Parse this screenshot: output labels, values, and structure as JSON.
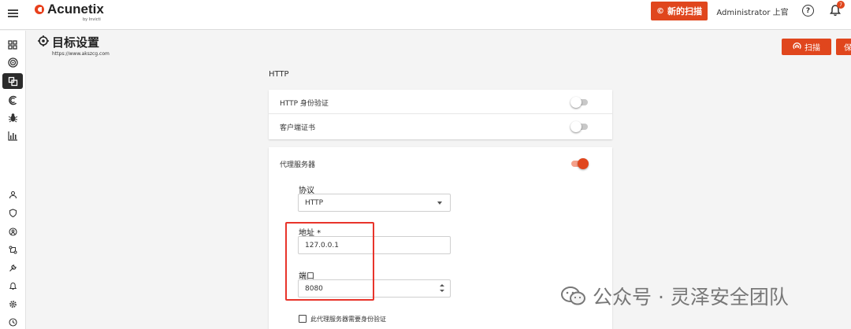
{
  "app": {
    "logo_text": "Acunetix",
    "logo_sub": "by Invicti",
    "new_scan_label": "新的扫描",
    "user_label": "Administrator 上官",
    "help_icon": "question-circle-icon",
    "notifications_count": "7"
  },
  "rail": {
    "items": [
      {
        "icon": "dashboard-icon"
      },
      {
        "icon": "target-icon"
      },
      {
        "icon": "targets-list-icon",
        "active": true
      },
      {
        "icon": "scans-icon"
      },
      {
        "icon": "vulnerabilities-bug-icon"
      },
      {
        "icon": "reports-chart-icon"
      },
      {
        "icon": "users-icon"
      },
      {
        "icon": "shield-icon"
      },
      {
        "icon": "issue-tracker-icon"
      },
      {
        "icon": "integrations-icon"
      },
      {
        "icon": "settings-wrench-icon"
      },
      {
        "icon": "notifications-bell-icon"
      },
      {
        "icon": "gear-icon"
      },
      {
        "icon": "history-clock-icon"
      }
    ]
  },
  "page": {
    "title": "目标设置",
    "url": "https://www.akszcg.com",
    "scan_label": "扫描",
    "save_label": "保存"
  },
  "http_section": {
    "heading": "HTTP",
    "rows": [
      {
        "label": "HTTP 身份验证",
        "enabled": false
      },
      {
        "label": "客户端证书",
        "enabled": false
      }
    ]
  },
  "proxy": {
    "label": "代理服务器",
    "enabled": true,
    "protocol_label": "协议",
    "protocol_value": "HTTP",
    "address_label": "地址 *",
    "address_value": "127.0.0.1",
    "port_label": "端口",
    "port_value": "8080",
    "auth_checkbox_label": "此代理服务器需要身份验证",
    "auth_checked": false
  },
  "watermark": {
    "text": "公众号 · 灵泽安全团队"
  },
  "colors": {
    "accent": "#e0461d",
    "highlight_box": "#e8342b"
  }
}
